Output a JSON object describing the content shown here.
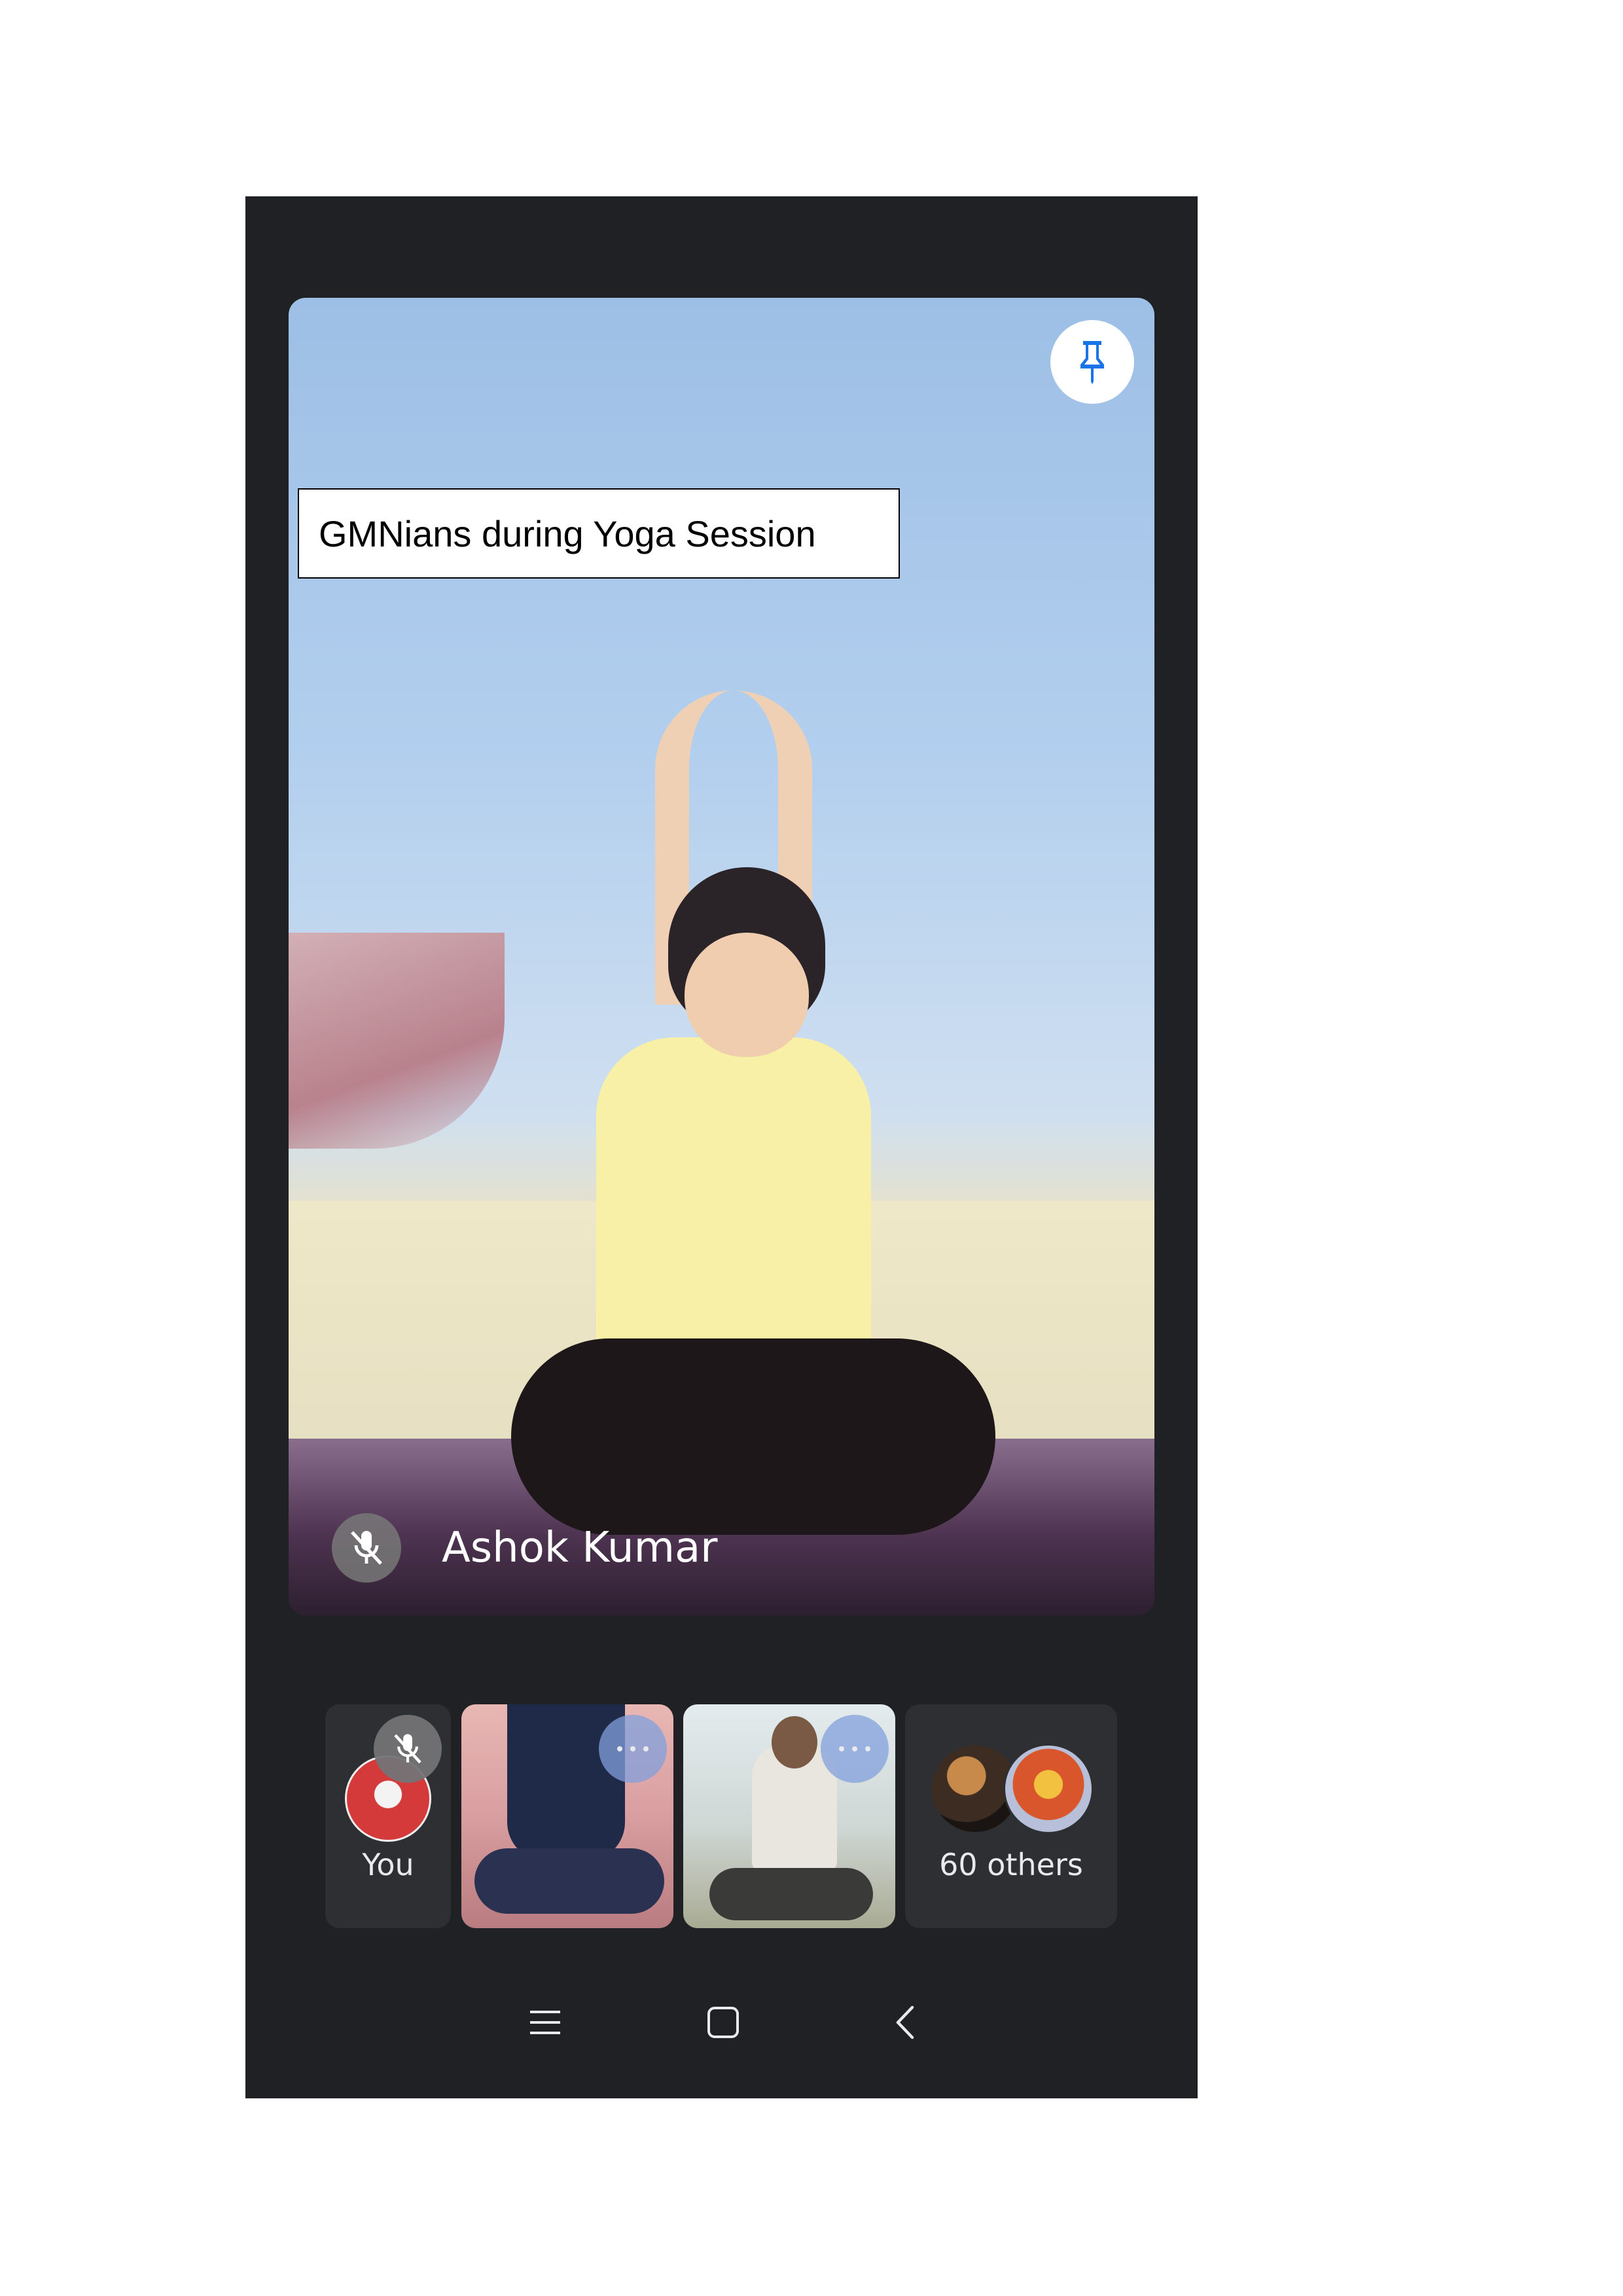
{
  "caption": "GMNians during Yoga Session",
  "main_video": {
    "participant_name": "Ashok Kumar",
    "mic_state": "muted",
    "pin_icon": "pin-icon"
  },
  "participant_tiles": [
    {
      "label": "You",
      "mic_state": "muted"
    },
    {
      "label": "",
      "icon": "more-dots-icon"
    },
    {
      "label": "",
      "icon": "more-dots-icon"
    },
    {
      "label": "60 others"
    }
  ],
  "nav_bar": {
    "items": [
      "menu-icon",
      "home-icon",
      "back-icon"
    ]
  },
  "colors": {
    "background": "#202124",
    "tile": "#2e2f33",
    "pin_blue": "#1a73e8"
  }
}
